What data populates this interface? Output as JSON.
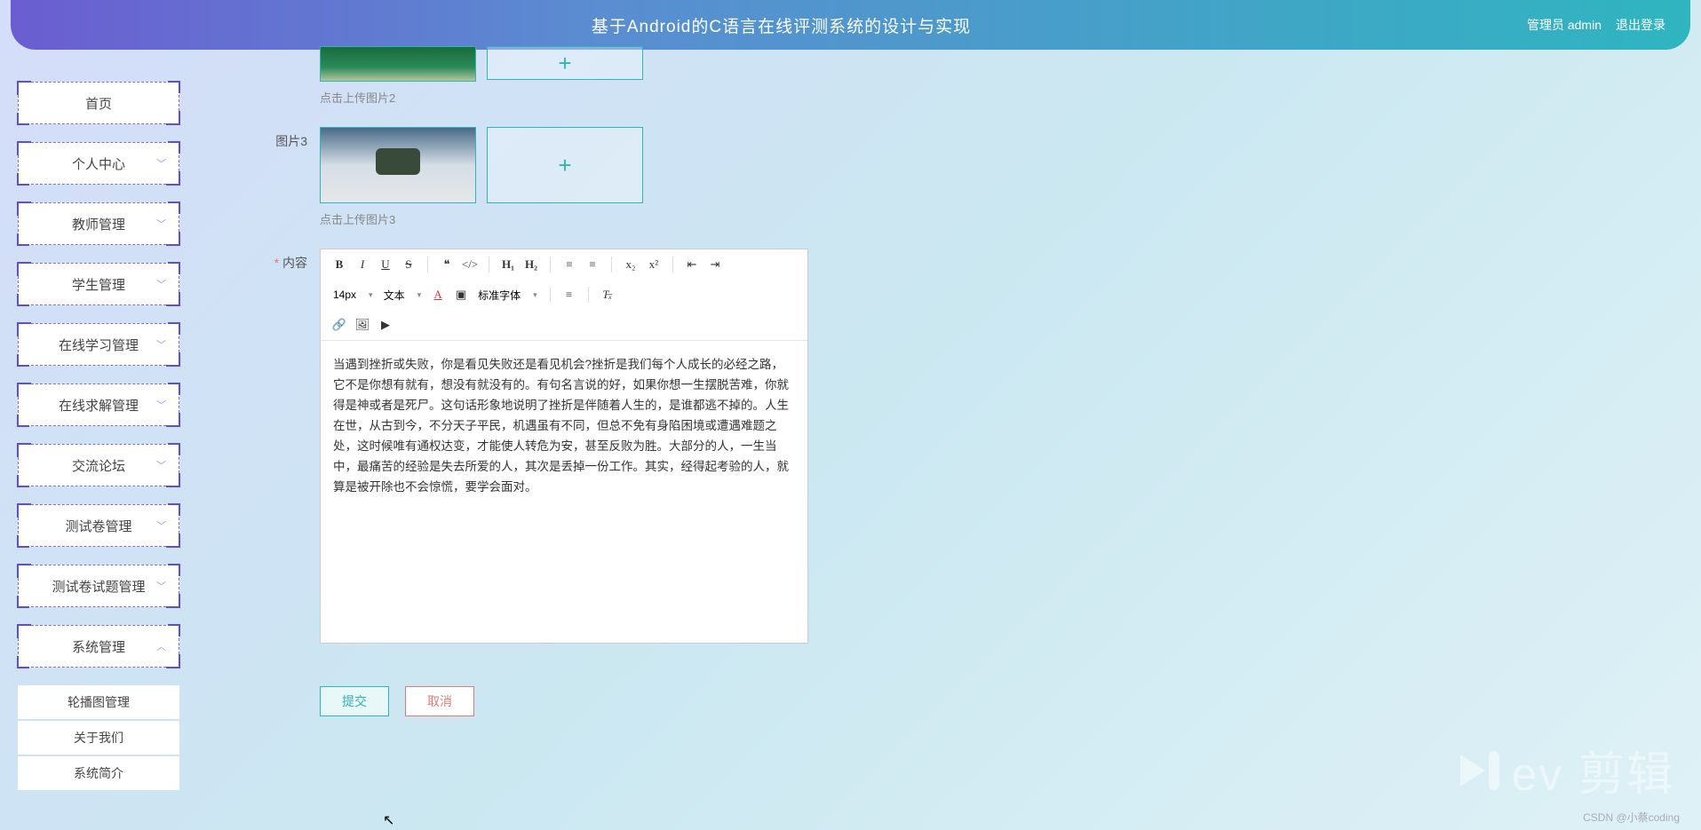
{
  "header": {
    "title": "基于Android的C语言在线评测系统的设计与实现",
    "user": "管理员 admin",
    "logout": "退出登录"
  },
  "sidebar": {
    "items": [
      {
        "label": "首页",
        "expandable": false
      },
      {
        "label": "个人中心",
        "expandable": true
      },
      {
        "label": "教师管理",
        "expandable": true
      },
      {
        "label": "学生管理",
        "expandable": true
      },
      {
        "label": "在线学习管理",
        "expandable": true
      },
      {
        "label": "在线求解管理",
        "expandable": true
      },
      {
        "label": "交流论坛",
        "expandable": true
      },
      {
        "label": "测试卷管理",
        "expandable": true
      },
      {
        "label": "测试卷试题管理",
        "expandable": true
      },
      {
        "label": "系统管理",
        "expandable": true,
        "open": true
      }
    ],
    "subitems": [
      {
        "label": "轮播图管理"
      },
      {
        "label": "关于我们"
      },
      {
        "label": "系统简介"
      }
    ]
  },
  "form": {
    "hint2": "点击上传图片2",
    "pic3_label": "图片3",
    "hint3": "点击上传图片3",
    "content_label": "内容",
    "content_text": "当遇到挫折或失败，你是看见失败还是看见机会?挫折是我们每个人成长的必经之路，它不是你想有就有，想没有就没有的。有句名言说的好，如果你想一生摆脱苦难，你就得是神或者是死尸。这句话形象地说明了挫折是伴随着人生的，是谁都逃不掉的。人生在世，从古到今，不分天子平民，机遇虽有不同，但总不免有身陷困境或遭遇难题之处，这时候唯有通权达变，才能使人转危为安，甚至反败为胜。大部分的人，一生当中，最痛苦的经验是失去所爱的人，其次是丢掉一份工作。其实，经得起考验的人，就算是被开除也不会惊慌，要学会面对。"
  },
  "editor_toolbar": {
    "font_size": "14px",
    "format": "文本",
    "font_family": "标准字体"
  },
  "actions": {
    "submit": "提交",
    "cancel": "取消"
  },
  "watermark": {
    "text": "ev 剪辑"
  },
  "csdn": "CSDN @小蔡coding"
}
